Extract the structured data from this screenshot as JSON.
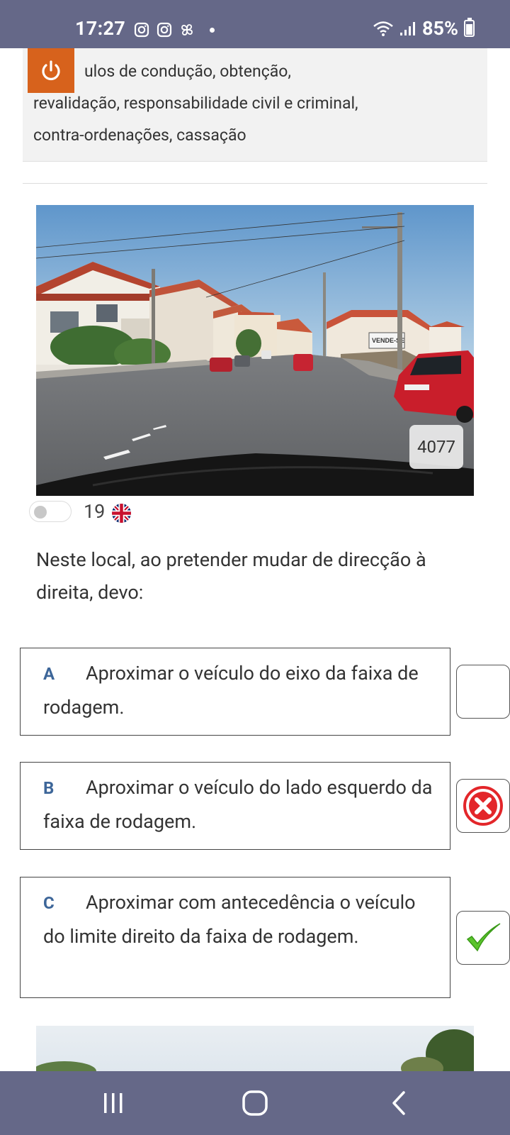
{
  "status_bar": {
    "time": "17:27",
    "battery": "85%",
    "battery_level": 0.85,
    "icons": [
      "instagram-icon",
      "instagram-icon",
      "pinwheel-app-icon",
      "notification-dot",
      "wifi-icon",
      "signal-icon",
      "battery-icon"
    ]
  },
  "topic": {
    "line1": "ulos de condução, obtenção,",
    "line2": "revalidação, responsabilidade civil e criminal,",
    "line3": "contra-ordenações, cassação"
  },
  "photo": {
    "id_label": "4077",
    "sign_text": "VENDE-SE"
  },
  "question": {
    "number": "19",
    "language_flag": "uk-flag-icon",
    "text": "Neste local, ao pretender mudar de direcção à direita, devo:"
  },
  "answers": [
    {
      "letter": "A",
      "text": "Aproximar o veículo do eixo da faixa de rodagem.",
      "state": "empty"
    },
    {
      "letter": "B",
      "text": "Aproximar o veículo do lado esquerdo da faixa de rodagem.",
      "state": "wrong"
    },
    {
      "letter": "C",
      "text": "Aproximar com antecedência o veículo do limite direito da faixa de rodagem.",
      "state": "correct"
    }
  ],
  "colors": {
    "status_bar": "#656888",
    "power_button": "#d7621c",
    "answer_letter": "#3d6699",
    "wrong": "#e3262a",
    "correct": "#5bc42c"
  }
}
